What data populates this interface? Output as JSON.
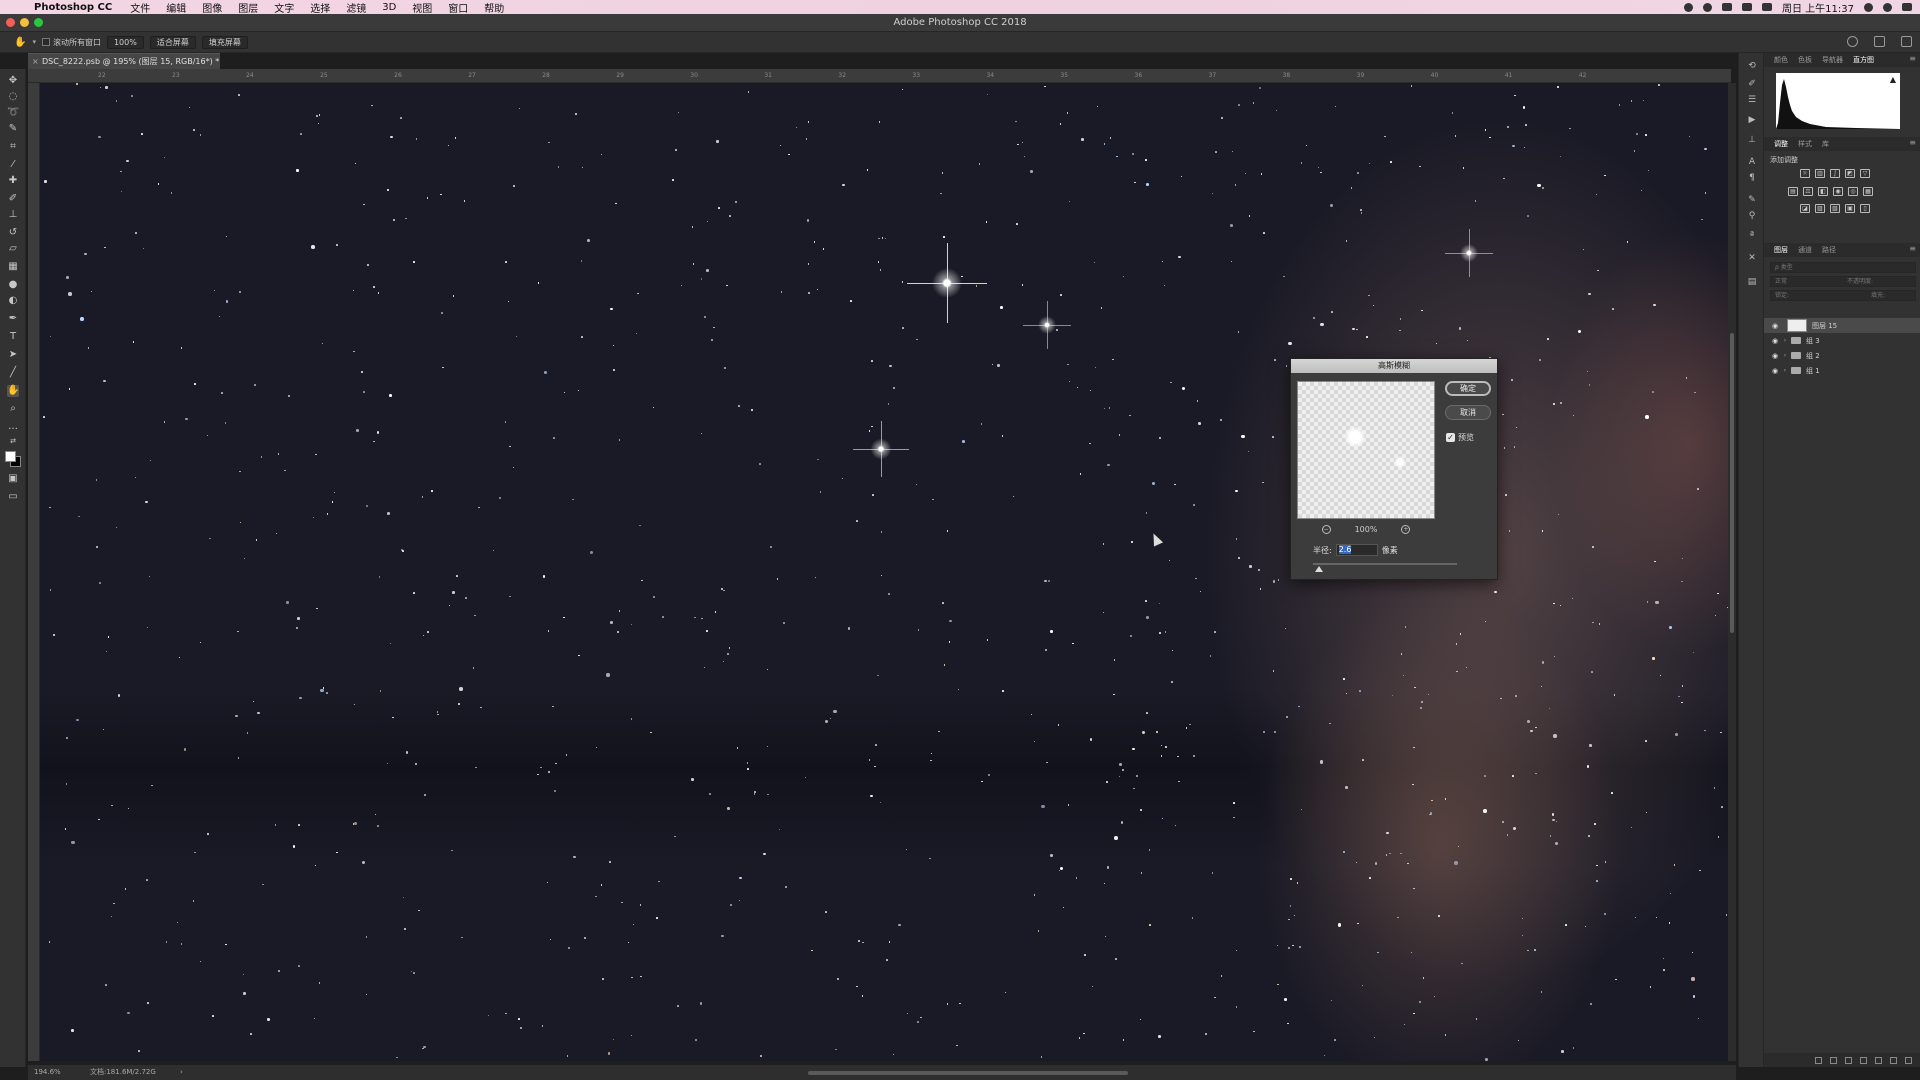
{
  "menubar": {
    "app_name": "Photoshop CC",
    "items": [
      "文件",
      "编辑",
      "图像",
      "图层",
      "文字",
      "选择",
      "滤镜",
      "3D",
      "视图",
      "窗口",
      "帮助"
    ],
    "clock": "周日 上午11:37"
  },
  "window": {
    "title": "Adobe Photoshop CC 2018"
  },
  "options_bar": {
    "scroll_all_label": "滚动所有窗口",
    "zoom_100": "100%",
    "fit_screen": "适合屏幕",
    "fill_screen": "填充屏幕"
  },
  "document": {
    "tab_title": "DSC_8222.psb @ 195% (图层 15, RGB/16*) *"
  },
  "rulers": {
    "top_ticks": [
      "22",
      "23",
      "24",
      "25",
      "26",
      "27",
      "28",
      "29",
      "30",
      "31",
      "32",
      "33",
      "34",
      "35",
      "36",
      "37",
      "38",
      "39",
      "40",
      "41",
      "42"
    ]
  },
  "status_bar": {
    "zoom": "194.6%",
    "doc_size": "文档:181.6M/2.72G"
  },
  "panels": {
    "top_tabs": [
      "颜色",
      "色板",
      "导航器",
      "直方图"
    ],
    "top_active": "直方图",
    "adjust_tabs": [
      "调整",
      "样式",
      "库"
    ],
    "adjust_active": "调整",
    "add_adjustment": "添加调整",
    "layers_tabs": [
      "图层",
      "通道",
      "路径"
    ],
    "layers_active": "图层",
    "layers_filter_label": "ρ 类型",
    "blend_mode": "正常",
    "opacity_label": "不透明度:",
    "lock_label": "锁定:",
    "fill_label": "填充:",
    "layers": [
      {
        "name": "图层 15",
        "type": "layer",
        "selected": true
      },
      {
        "name": "组 3",
        "type": "group",
        "selected": false
      },
      {
        "name": "组 2",
        "type": "group",
        "selected": false
      },
      {
        "name": "组 1",
        "type": "group",
        "selected": false
      }
    ]
  },
  "dialog": {
    "title": "高斯模糊",
    "ok_label": "确定",
    "cancel_label": "取消",
    "preview_label": "预览",
    "preview_checked": true,
    "zoom_level": "100%",
    "radius_label": "半径:",
    "radius_value": "2.6",
    "radius_unit": "像素"
  },
  "colors": {
    "foreground": "#ffffff",
    "background": "#000000",
    "accent": "#3469c5"
  }
}
